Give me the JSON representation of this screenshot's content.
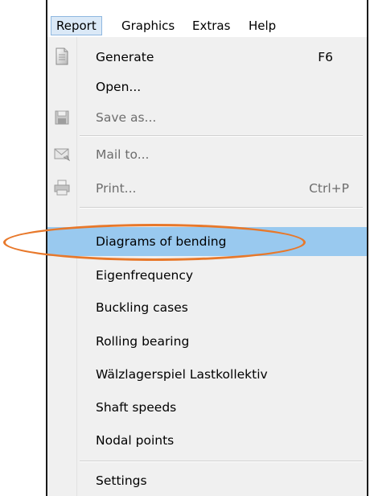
{
  "menubar": {
    "items": [
      {
        "label": "Report"
      },
      {
        "label": "Graphics"
      },
      {
        "label": "Extras"
      },
      {
        "label": "Help"
      }
    ]
  },
  "report_menu": {
    "generate": {
      "label": "Generate",
      "shortcut": "F6",
      "icon": "document-icon"
    },
    "open": {
      "label": "Open..."
    },
    "save_as": {
      "label": "Save as...",
      "icon": "floppy-disk-icon",
      "disabled": true
    },
    "mail_to": {
      "label": "Mail to...",
      "icon": "mail-icon",
      "disabled": true
    },
    "print": {
      "label": "Print...",
      "shortcut": "Ctrl+P",
      "icon": "printer-icon",
      "disabled": true
    },
    "diagrams_of_bending": {
      "label": "Diagrams of bending",
      "highlighted": true
    },
    "eigenfrequency": {
      "label": "Eigenfrequency"
    },
    "buckling_cases": {
      "label": "Buckling cases"
    },
    "rolling_bearing": {
      "label": "Rolling bearing"
    },
    "waelzlagerspiel": {
      "label": "Wälzlagerspiel Lastkollektiv"
    },
    "shaft_speeds": {
      "label": "Shaft speeds"
    },
    "nodal_points": {
      "label": "Nodal points"
    },
    "settings": {
      "label": "Settings"
    }
  },
  "colors": {
    "highlight": "#99c9ef",
    "annotation": "#e8782a",
    "disabled_text": "#6d6d6d"
  }
}
